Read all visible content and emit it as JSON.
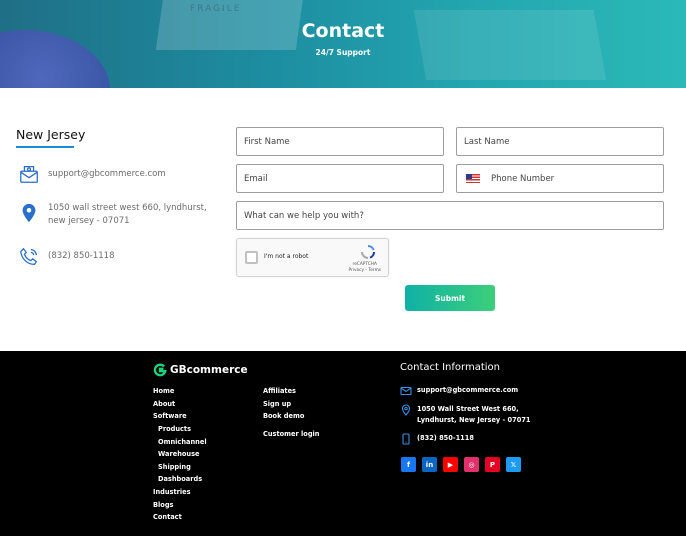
{
  "hero": {
    "title": "Contact",
    "subtitle": "24/7 Support",
    "stamp_text": "FRAGILE"
  },
  "location": {
    "region": "New Jersey",
    "email": "support@gbcommerce.com",
    "address_line1": "1050 wall street west 660, lyndhurst,",
    "address_line2": "new jersey - 07071",
    "phone": "(832) 850-1118"
  },
  "form": {
    "first_name_placeholder": "First Name",
    "last_name_placeholder": "Last Name",
    "email_placeholder": "Email",
    "phone_placeholder": "Phone Number",
    "message_placeholder": "What can we help you with?",
    "captcha_label": "I'm not a robot",
    "captcha_brand": "reCAPTCHA",
    "captcha_links": "Privacy - Terms",
    "submit_label": "Submit"
  },
  "footer": {
    "brand": "GBcommerce",
    "nav_col1": [
      "Home",
      "About",
      "Software"
    ],
    "nav_software_sub": [
      "Products",
      "Omnichannel",
      "Warehouse",
      "Shipping",
      "Dashboards"
    ],
    "nav_col1_after": [
      "Industries",
      "Blogs",
      "Contact"
    ],
    "nav_col2": [
      "Affiliates",
      "Sign up",
      "Book demo",
      "Customer login"
    ],
    "contact_title": "Contact Information",
    "contact_email": "support@gbcommerce.com",
    "contact_address_line1": "1050 Wall Street West 660,",
    "contact_address_line2": "Lyndhurst, New Jersey - 07071",
    "contact_phone": "(832) 850-1118",
    "social": [
      {
        "icon": "facebook-icon",
        "glyph": "f",
        "color": "#1877f2"
      },
      {
        "icon": "linkedin-icon",
        "glyph": "in",
        "color": "#0a66c2"
      },
      {
        "icon": "youtube-icon",
        "glyph": "▶",
        "color": "#ff0000"
      },
      {
        "icon": "instagram-icon",
        "glyph": "◎",
        "color": "#e1306c"
      },
      {
        "icon": "pinterest-icon",
        "glyph": "P",
        "color": "#e60023"
      },
      {
        "icon": "x-icon",
        "glyph": "𝕏",
        "color": "#1d9bf0"
      }
    ]
  },
  "colors": {
    "accent": "#1a8cd8",
    "submit_start": "#0fb1a6",
    "submit_end": "#3ccf7a",
    "footer_bg": "#000000"
  }
}
